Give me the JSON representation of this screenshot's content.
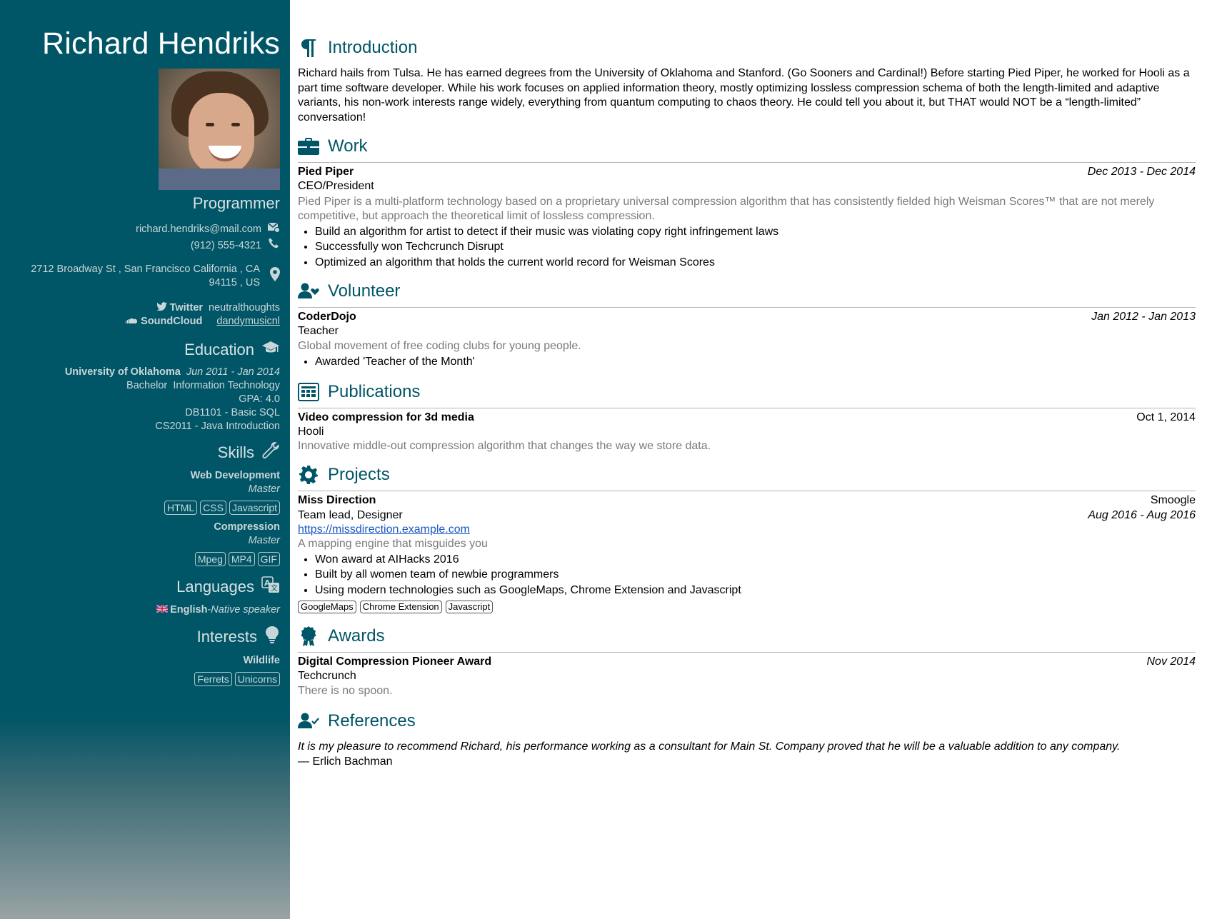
{
  "sidebar": {
    "name": "Richard Hendriks",
    "role": "Programmer",
    "email": "richard.hendriks@mail.com",
    "phone": "(912) 555-4321",
    "address_line1": "2712 Broadway St , San Francisco California , CA",
    "address_line2": "94115 , US",
    "profiles": [
      {
        "network": "Twitter",
        "username": "neutralthoughts",
        "icon": "twitter-icon"
      },
      {
        "network": "SoundCloud",
        "username": "dandymusicnl",
        "icon": "soundcloud-icon"
      }
    ],
    "education": {
      "heading": "Education",
      "institution": "University of Oklahoma",
      "dates": "Jun 2011 - Jan 2014",
      "degree": "Bachelor",
      "area": "Information Technology",
      "gpa": "GPA: 4.0",
      "courses": [
        "DB1101 - Basic SQL",
        "CS2011 - Java Introduction"
      ]
    },
    "skills": {
      "heading": "Skills",
      "items": [
        {
          "name": "Web Development",
          "level": "Master",
          "keywords": [
            "HTML",
            "CSS",
            "Javascript"
          ]
        },
        {
          "name": "Compression",
          "level": "Master",
          "keywords": [
            "Mpeg",
            "MP4",
            "GIF"
          ]
        }
      ]
    },
    "languages": {
      "heading": "Languages",
      "language": "English",
      "separator": "- ",
      "fluency": "Native speaker"
    },
    "interests": {
      "heading": "Interests",
      "name": "Wildlife",
      "keywords": [
        "Ferrets",
        "Unicorns"
      ]
    }
  },
  "main": {
    "intro": {
      "heading": "Introduction",
      "text": "Richard hails from Tulsa. He has earned degrees from the University of Oklahoma and Stanford. (Go Sooners and Cardinal!) Before starting Pied Piper, he worked for Hooli as a part time software developer. While his work focuses on applied information theory, mostly optimizing lossless compression schema of both the length-limited and adaptive variants, his non-work interests range widely, everything from quantum computing to chaos theory. He could tell you about it, but THAT would NOT be a “length-limited” conversation!"
    },
    "work": {
      "heading": "Work",
      "company": "Pied Piper",
      "dates": "Dec 2013 - Dec 2014",
      "position": "CEO/President",
      "summary": "Pied Piper is a multi-platform technology based on a proprietary universal compression algorithm that has consistently fielded high Weisman Scores™ that are not merely competitive, but approach the theoretical limit of lossless compression.",
      "highlights": [
        "Build an algorithm for artist to detect if their music was violating copy right infringement laws",
        "Successfully won Techcrunch Disrupt",
        "Optimized an algorithm that holds the current world record for Weisman Scores"
      ]
    },
    "volunteer": {
      "heading": "Volunteer",
      "organization": "CoderDojo",
      "dates": "Jan 2012 - Jan 2013",
      "position": "Teacher",
      "summary": "Global movement of free coding clubs for young people.",
      "highlights": [
        "Awarded 'Teacher of the Month'"
      ]
    },
    "publications": {
      "heading": "Publications",
      "name": "Video compression for 3d media",
      "date": "Oct 1, 2014",
      "publisher": "Hooli",
      "summary": "Innovative middle-out compression algorithm that changes the way we store data."
    },
    "projects": {
      "heading": "Projects",
      "name": "Miss Direction",
      "entity": "Smoogle",
      "roles": "Team lead, Designer",
      "dates": "Aug 2016 - Aug 2016",
      "url": "https://missdirection.example.com",
      "description": "A mapping engine that misguides you",
      "highlights": [
        "Won award at AIHacks 2016",
        "Built by all women team of newbie programmers",
        "Using modern technologies such as GoogleMaps, Chrome Extension and Javascript"
      ],
      "keywords": [
        "GoogleMaps",
        "Chrome Extension",
        "Javascript"
      ]
    },
    "awards": {
      "heading": "Awards",
      "title": "Digital Compression Pioneer Award",
      "date": "Nov 2014",
      "awarder": "Techcrunch",
      "summary": "There is no spoon."
    },
    "references": {
      "heading": "References",
      "quote": "It is my pleasure to recommend Richard, his performance working as a consultant for Main St. Company proved that he will be a valuable addition to any company.",
      "author": "— Erlich Bachman"
    }
  },
  "colors": {
    "sidebar_bg": "#005566",
    "accent": "#005566",
    "link": "#1a56c4"
  }
}
